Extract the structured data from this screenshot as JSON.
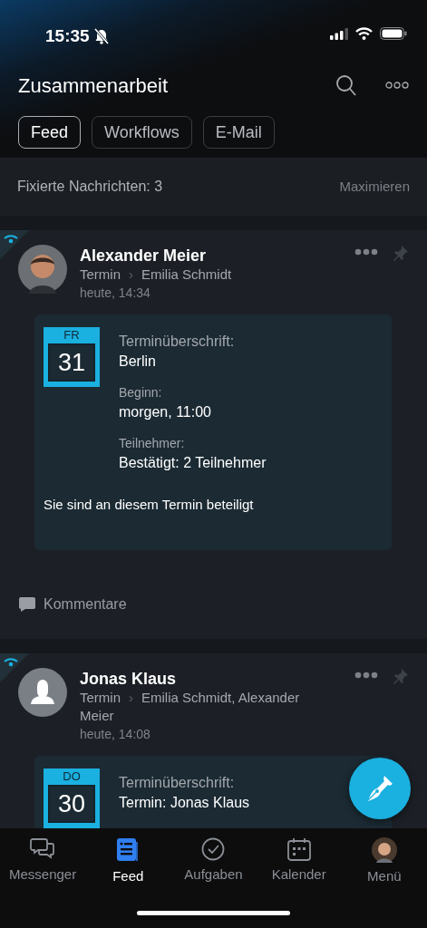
{
  "status_bar": {
    "time": "15:35"
  },
  "header": {
    "title": "Zusammenarbeit"
  },
  "tabs": [
    {
      "label": "Feed",
      "selected": true
    },
    {
      "label": "Workflows",
      "selected": false
    },
    {
      "label": "E-Mail",
      "selected": false
    }
  ],
  "pinned": {
    "label": "Fixierte Nachrichten: 3",
    "action": "Maximieren"
  },
  "posts": [
    {
      "author": "Alexander Meier",
      "avatar": {
        "kind": "photo"
      },
      "type": "Termin",
      "separator": "›",
      "recipients": "Emilia Schmidt",
      "time": "heute, 14:34",
      "event": {
        "weekday": "FR",
        "day": "31",
        "fields": [
          {
            "label": "Terminüberschrift:",
            "value": "Berlin"
          },
          {
            "label": "Beginn:",
            "value": "morgen, 11:00"
          },
          {
            "label": "Teilnehmer:",
            "value": "Bestätigt: 2 Teilnehmer"
          }
        ],
        "note": "Sie sind an diesem Termin beteiligt"
      },
      "comments": "Kommentare"
    },
    {
      "author": "Jonas Klaus",
      "avatar": {
        "kind": "placeholder"
      },
      "type": "Termin",
      "separator": "›",
      "recipients": "Emilia Schmidt, Alexander Meier",
      "time": "heute, 14:08",
      "event": {
        "weekday": "DO",
        "day": "30",
        "fields": [
          {
            "label": "Terminüberschrift:",
            "value": "Termin: Jonas Klaus"
          }
        ]
      }
    }
  ],
  "nav": [
    {
      "label": "Messenger",
      "kind": "chat",
      "selected": false
    },
    {
      "label": "Feed",
      "kind": "feed",
      "selected": true
    },
    {
      "label": "Aufgaben",
      "kind": "check",
      "selected": false
    },
    {
      "label": "Kalender",
      "kind": "calendar",
      "selected": false
    },
    {
      "label": "Menü",
      "kind": "avatar",
      "selected": false
    }
  ]
}
